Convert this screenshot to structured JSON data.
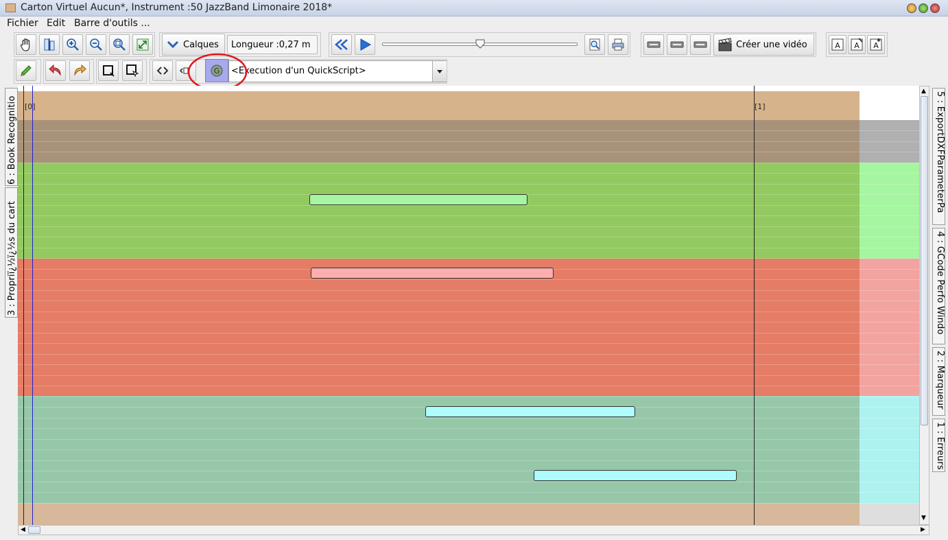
{
  "window": {
    "title": "Carton Virtuel  Aucun*, Instrument :50 JazzBand Limonaire 2018*"
  },
  "menu": {
    "items": [
      "Fichier",
      "Edit",
      "Barre d'outils ..."
    ]
  },
  "toolbar1": {
    "calques_label": "Calques",
    "length_label": "Longueur :0,27 m",
    "video_label": "Créer une vidéo",
    "slider_value_fraction": 0.5
  },
  "toolbar2": {
    "quickscript_value": "<Execution d'un QuickScript>"
  },
  "left_tabs": [
    "6 : Book Recognitio",
    "3 : Propriï¿½ï¿½s du cart"
  ],
  "right_tabs": [
    "5 : ExportDXFParameterPa",
    "4 : GCode Perfo Windo",
    "2 : Marqueur",
    "1 : Erreurs"
  ],
  "markers": [
    "[0]",
    "[1]"
  ],
  "colors": {
    "header_band": "#d7b38c",
    "gray_band": "#a8927a",
    "green_band": "#93c961",
    "red_band": "#e47c66",
    "cyan_band": "#97c7a9",
    "green_note": "#a6f5a0",
    "red_note": "#fcaeae",
    "cyan_note": "#aefcfc",
    "highlight_circle": "#e0161c",
    "selected_tool": "#a8a8ee"
  }
}
